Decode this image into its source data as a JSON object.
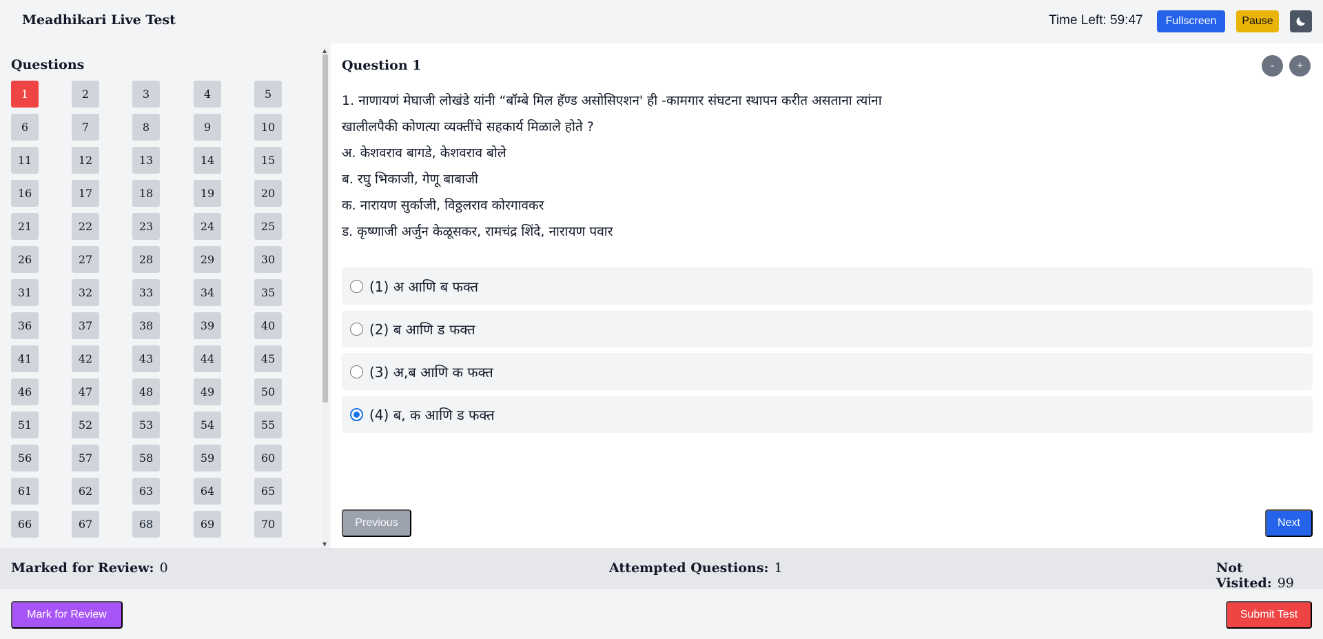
{
  "header": {
    "title": "Meadhikari Live Test",
    "time_left": "Time Left: 59:47",
    "fullscreen_label": "Fullscreen",
    "pause_label": "Pause",
    "theme_icon": "moon-icon"
  },
  "sidebar": {
    "heading": "Questions",
    "current_question": 1,
    "question_numbers": [
      "1",
      "2",
      "3",
      "4",
      "5",
      "6",
      "7",
      "8",
      "9",
      "10",
      "11",
      "12",
      "13",
      "14",
      "15",
      "16",
      "17",
      "18",
      "19",
      "20",
      "21",
      "22",
      "23",
      "24",
      "25",
      "26",
      "27",
      "28",
      "29",
      "30",
      "31",
      "32",
      "33",
      "34",
      "35",
      "36",
      "37",
      "38",
      "39",
      "40",
      "41",
      "42",
      "43",
      "44",
      "45",
      "46",
      "47",
      "48",
      "49",
      "50",
      "51",
      "52",
      "53",
      "54",
      "55",
      "56",
      "57",
      "58",
      "59",
      "60",
      "61",
      "62",
      "63",
      "64",
      "65",
      "66",
      "67",
      "68",
      "69",
      "70"
    ]
  },
  "question": {
    "title": "Question 1",
    "zoom_out": "-",
    "zoom_in": "+",
    "lines": [
      "1. नाणायणं मेघाजी लोखंडे यांनी “बॉम्बे मिल हॅण्ड असोसिएशन' ही -कामगार संघटना स्थापन करीत असताना त्यांना",
      "खालीलपैकी कोणत्या व्यक्तींचे सहकार्य मिळाले होते ?",
      "अ. केशवराव बागडे, केशवराव बोले",
      "ब. रघु भिकाजी, गेणू बाबाजी",
      "क. नारायण सुर्काजी, विठ्ठलराव कोरगावकर",
      "ड. कृष्णाजी अर्जुन केळूसकर, रामचंद्र शिंदे, नारायण पवार"
    ],
    "options": [
      {
        "label": "(1) अ आणि ब फक्त",
        "selected": false
      },
      {
        "label": "(2) ब आणि ड फक्त",
        "selected": false
      },
      {
        "label": "(3) अ,ब आणि क फक्त",
        "selected": false
      },
      {
        "label": "(4) ब, क आणि ड फक्त",
        "selected": true
      }
    ],
    "previous_label": "Previous",
    "next_label": "Next"
  },
  "status": {
    "marked_label": "Marked for Review:",
    "marked_value": "0",
    "attempted_label": "Attempted Questions:",
    "attempted_value": "1",
    "not_visited_label": "Not Visited:",
    "not_visited_value": "99"
  },
  "footer": {
    "mark_label": "Mark for Review",
    "submit_label": "Submit Test"
  },
  "colors": {
    "current_question": "#ef4444",
    "primary": "#2563eb",
    "pause": "#eab308",
    "mark": "#a855f7",
    "submit": "#ef4444"
  }
}
